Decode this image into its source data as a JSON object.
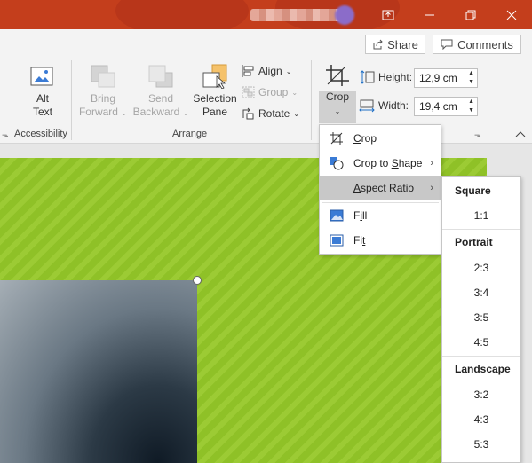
{
  "titlebar": {
    "buttons": [
      "⧉",
      "—",
      "❐",
      "✕"
    ]
  },
  "header": {
    "share_label": "Share",
    "comments_label": "Comments"
  },
  "ribbon": {
    "alt_text": [
      "Alt",
      "Text"
    ],
    "bring_forward": [
      "Bring",
      "Forward"
    ],
    "send_backward": [
      "Send",
      "Backward"
    ],
    "selection_pane": [
      "Selection",
      "Pane"
    ],
    "align": "Align",
    "group": "Group",
    "rotate": "Rotate",
    "crop": "Crop",
    "height_label": "Height:",
    "height_value": "12,9 cm",
    "width_label": "Width:",
    "width_value": "19,4 cm",
    "groups": [
      "Accessibility",
      "Arrange"
    ],
    "collapse": "^"
  },
  "crop_menu": {
    "items": [
      {
        "label": "Crop",
        "accel": "C",
        "rest": "rop",
        "icon": "crop-icon"
      },
      {
        "label": "Crop to Shape",
        "accel": "S",
        "pre": "Crop to ",
        "rest": "hape",
        "icon": "crop-to-shape-icon"
      },
      {
        "label": "Aspect Ratio",
        "accel": "A",
        "rest": "spect Ratio",
        "icon": ""
      },
      {
        "label": "Fill",
        "accel": "i",
        "pre": "F",
        "rest": "ll",
        "icon": "fill-icon"
      },
      {
        "label": "Fit",
        "accel": "t",
        "pre": "Fi",
        "rest": "",
        "icon": "fit-icon"
      }
    ]
  },
  "aspect_menu": {
    "sections": [
      {
        "heading": "Square",
        "items": [
          "1:1"
        ]
      },
      {
        "heading": "Portrait",
        "items": [
          "2:3",
          "3:4",
          "3:5",
          "4:5"
        ]
      },
      {
        "heading": "Landscape",
        "items": [
          "3:2",
          "4:3",
          "5:3"
        ]
      }
    ]
  },
  "colors": {
    "titlebar": "#c43e1c",
    "slide_green": "#8fc127",
    "menu_highlight": "#c8c8c8"
  }
}
